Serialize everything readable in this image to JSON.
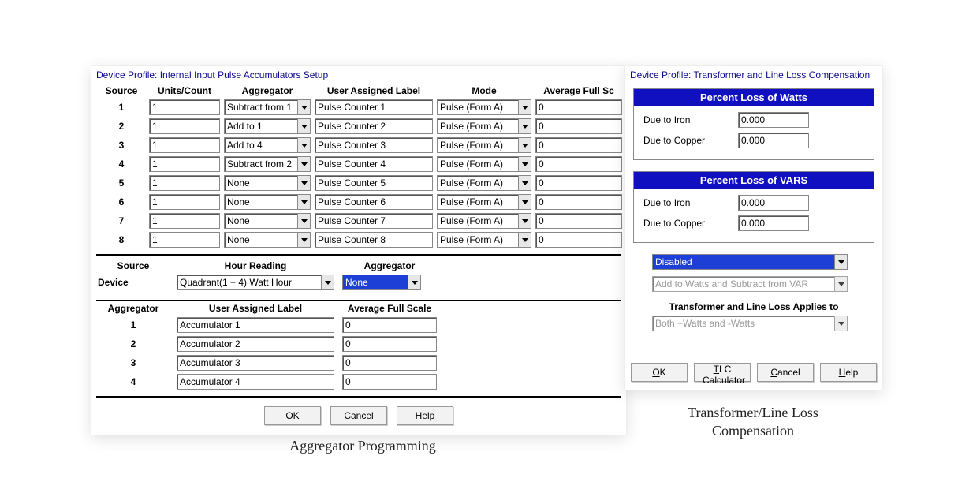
{
  "agg_dialog": {
    "title": "Device Profile: Internal Input Pulse Accumulators Setup",
    "headers": {
      "source": "Source",
      "units": "Units/Count",
      "aggregator": "Aggregator",
      "user_label": "User Assigned Label",
      "mode": "Mode",
      "avg_full": "Average Full Sc"
    },
    "rows": [
      {
        "n": "1",
        "units": "1",
        "agg": "Subtract from 1",
        "label": "Pulse Counter 1",
        "mode": "Pulse (Form A)",
        "avg": "0"
      },
      {
        "n": "2",
        "units": "1",
        "agg": "Add to 1",
        "label": "Pulse Counter 2",
        "mode": "Pulse (Form A)",
        "avg": "0"
      },
      {
        "n": "3",
        "units": "1",
        "agg": "Add to 4",
        "label": "Pulse Counter 3",
        "mode": "Pulse (Form A)",
        "avg": "0"
      },
      {
        "n": "4",
        "units": "1",
        "agg": "Subtract from 2",
        "label": "Pulse Counter 4",
        "mode": "Pulse (Form A)",
        "avg": "0"
      },
      {
        "n": "5",
        "units": "1",
        "agg": "None",
        "label": "Pulse Counter 5",
        "mode": "Pulse (Form A)",
        "avg": "0"
      },
      {
        "n": "6",
        "units": "1",
        "agg": "None",
        "label": "Pulse Counter 6",
        "mode": "Pulse (Form A)",
        "avg": "0"
      },
      {
        "n": "7",
        "units": "1",
        "agg": "None",
        "label": "Pulse Counter 7",
        "mode": "Pulse (Form A)",
        "avg": "0"
      },
      {
        "n": "8",
        "units": "1",
        "agg": "None",
        "label": "Pulse Counter 8",
        "mode": "Pulse (Form A)",
        "avg": "0"
      }
    ],
    "section2": {
      "hdr_source": "Source",
      "hdr_hour": "Hour Reading",
      "hdr_agg": "Aggregator",
      "device_label": "Device",
      "hour_value": "Quadrant(1 + 4) Watt Hour",
      "agg_value": "None"
    },
    "section3": {
      "hdr_agg": "Aggregator",
      "hdr_label": "User Assigned Label",
      "hdr_avg": "Average Full Scale",
      "rows": [
        {
          "n": "1",
          "label": "Accumulator 1",
          "avg": "0"
        },
        {
          "n": "2",
          "label": "Accumulator 2",
          "avg": "0"
        },
        {
          "n": "3",
          "label": "Accumulator 3",
          "avg": "0"
        },
        {
          "n": "4",
          "label": "Accumulator 4",
          "avg": "0"
        }
      ]
    },
    "buttons": {
      "ok": "OK",
      "cancel_pre": "C",
      "cancel_rest": "ancel",
      "help": "Help"
    }
  },
  "tlc_dialog": {
    "title": "Device Profile: Transformer and Line Loss Compensation",
    "watts_title": "Percent Loss of Watts",
    "vars_title": "Percent Loss of VARS",
    "due_iron": "Due to Iron",
    "due_copper": "Due to Copper",
    "watts_iron": "0.000",
    "watts_copper": "0.000",
    "vars_iron": "0.000",
    "vars_copper": "0.000",
    "sel1": "Disabled",
    "sel2": "Add to Watts and Subtract from VAR",
    "applies_label": "Transformer and Line Loss Applies to",
    "applies_value": "Both +Watts and -Watts",
    "buttons": {
      "ok_u": "O",
      "ok_rest": "K",
      "tlc_u": "T",
      "tlc_rest": "LC Calculator",
      "cancel_u": "C",
      "cancel_rest": "ancel",
      "help_u": "H",
      "help_rest": "elp"
    }
  },
  "captions": {
    "agg": "Aggregator Programming",
    "tlc": "Transformer/Line Loss Compensation"
  }
}
